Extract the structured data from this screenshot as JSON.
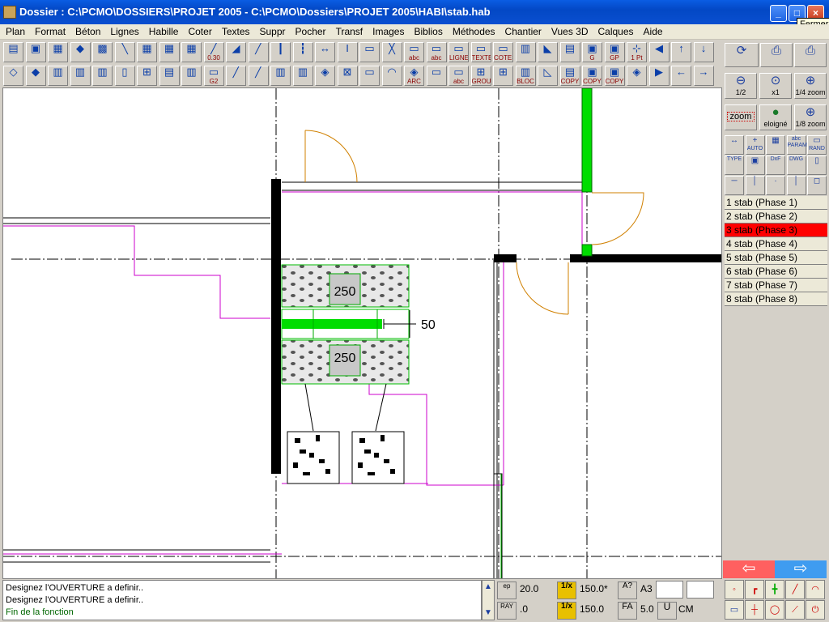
{
  "window": {
    "title": "Dossier : C:\\PCMO\\DOSSIERS\\PROJET 2005 - C:\\PCMO\\Dossiers\\PROJET 2005\\HABI\\stab.hab",
    "close_tooltip": "Fermer"
  },
  "menu": [
    "Plan",
    "Format",
    "Béton",
    "Lignes",
    "Habille",
    "Coter",
    "Textes",
    "Suppr",
    "Pocher",
    "Transf",
    "Images",
    "Biblios",
    "Méthodes",
    "Chantier",
    "Vues 3D",
    "Calques",
    "Aide"
  ],
  "toolbar1": [
    "",
    "",
    "",
    "",
    "",
    "",
    "",
    "",
    "",
    "0.30",
    "",
    "",
    "",
    "",
    "",
    "",
    "",
    "",
    "abc",
    "abc",
    "LIGNE",
    "TEXTE",
    "COTES",
    "",
    "",
    "",
    "G",
    "GP",
    "1 Pt",
    "",
    "",
    ""
  ],
  "toolbar2": [
    "",
    "",
    "",
    "",
    "",
    "",
    "",
    "",
    "",
    "G2",
    "",
    "",
    "",
    "",
    "",
    "",
    "",
    "",
    "ARC",
    "",
    "abc",
    "GROUP",
    "",
    "BLOC",
    "",
    "COPY",
    "COPY",
    "COPY",
    "",
    "",
    "",
    ""
  ],
  "right_panel": {
    "zoom_half": "1/2",
    "zoom_x1": "x1",
    "zoom_quarter": "1/4 zoom",
    "zoom_label": "zoom",
    "far_label": "eloigné",
    "zoom_eighth": "1/8 zoom",
    "small_buttons": [
      "",
      "AUTO",
      "",
      "abc PARAM",
      "RAND",
      "TYPE",
      "",
      "DxF",
      "DWG",
      "",
      "",
      "",
      "",
      "",
      ""
    ]
  },
  "phases": [
    {
      "label": "1 stab (Phase 1)",
      "active": false
    },
    {
      "label": "2 stab (Phase 2)",
      "active": false
    },
    {
      "label": "3 stab (Phase 3)",
      "active": true
    },
    {
      "label": "4 stab (Phase 4)",
      "active": false
    },
    {
      "label": "5 stab (Phase 5)",
      "active": false
    },
    {
      "label": "6 stab (Phase 6)",
      "active": false
    },
    {
      "label": "7 stab (Phase 7)",
      "active": false
    },
    {
      "label": "8 stab (Phase 8)",
      "active": false
    }
  ],
  "drawing": {
    "dim_top": "250",
    "dim_bottom": "250",
    "dim_side": "50"
  },
  "messages": [
    "Designez l'OUVERTURE a definir..",
    "Designez l'OUVERTURE a definir..",
    "Fin de la fonction"
  ],
  "bottom": {
    "ep_label": "ep",
    "ep_value": "20.0",
    "ray_label": "RAY",
    "ray_value": ".0",
    "scale_top_label": "1/x",
    "scale_top_value": "150.0*",
    "scale_bottom_label": "1/x",
    "scale_bottom_value": "150.0",
    "paper_label": "A?",
    "paper_value": "A3",
    "fa_label": "FA",
    "fa_value": "5.0",
    "unit_label": "U",
    "unit_value": "CM"
  },
  "colors": {
    "wall": "#000000",
    "accent_green": "#00dd00",
    "magenta": "#cc00cc",
    "door": "#d08000",
    "active_phase": "#ff0000"
  }
}
